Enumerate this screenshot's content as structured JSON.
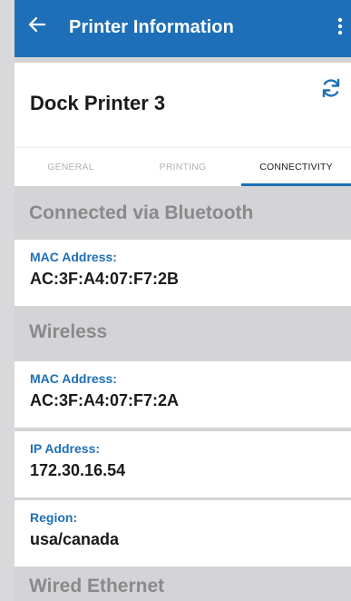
{
  "appbar": {
    "title": "Printer Information",
    "back_icon": "arrow-left-icon",
    "more_icon": "more-vert-icon",
    "background": "#1e6fb7"
  },
  "printer": {
    "name": "Dock Printer 3",
    "refresh_icon": "refresh-icon"
  },
  "tabs": [
    {
      "label": "GENERAL",
      "active": false
    },
    {
      "label": "PRINTING",
      "active": false
    },
    {
      "label": "CONNECTIVITY",
      "active": true
    }
  ],
  "sections": {
    "bluetooth": {
      "header": "Connected via Bluetooth",
      "rows": [
        {
          "label": "MAC Address:",
          "value": "AC:3F:A4:07:F7:2B"
        }
      ]
    },
    "wireless": {
      "header": "Wireless",
      "rows": [
        {
          "label": "MAC Address:",
          "value": "AC:3F:A4:07:F7:2A"
        },
        {
          "label": "IP Address:",
          "value": "172.30.16.54"
        },
        {
          "label": "Region:",
          "value": "usa/canada"
        }
      ]
    },
    "wired": {
      "header": "Wired Ethernet"
    }
  },
  "colors": {
    "accent": "#1e6fb7",
    "section_header_text": "#8a8a8c",
    "background": "#d4d4d6"
  }
}
